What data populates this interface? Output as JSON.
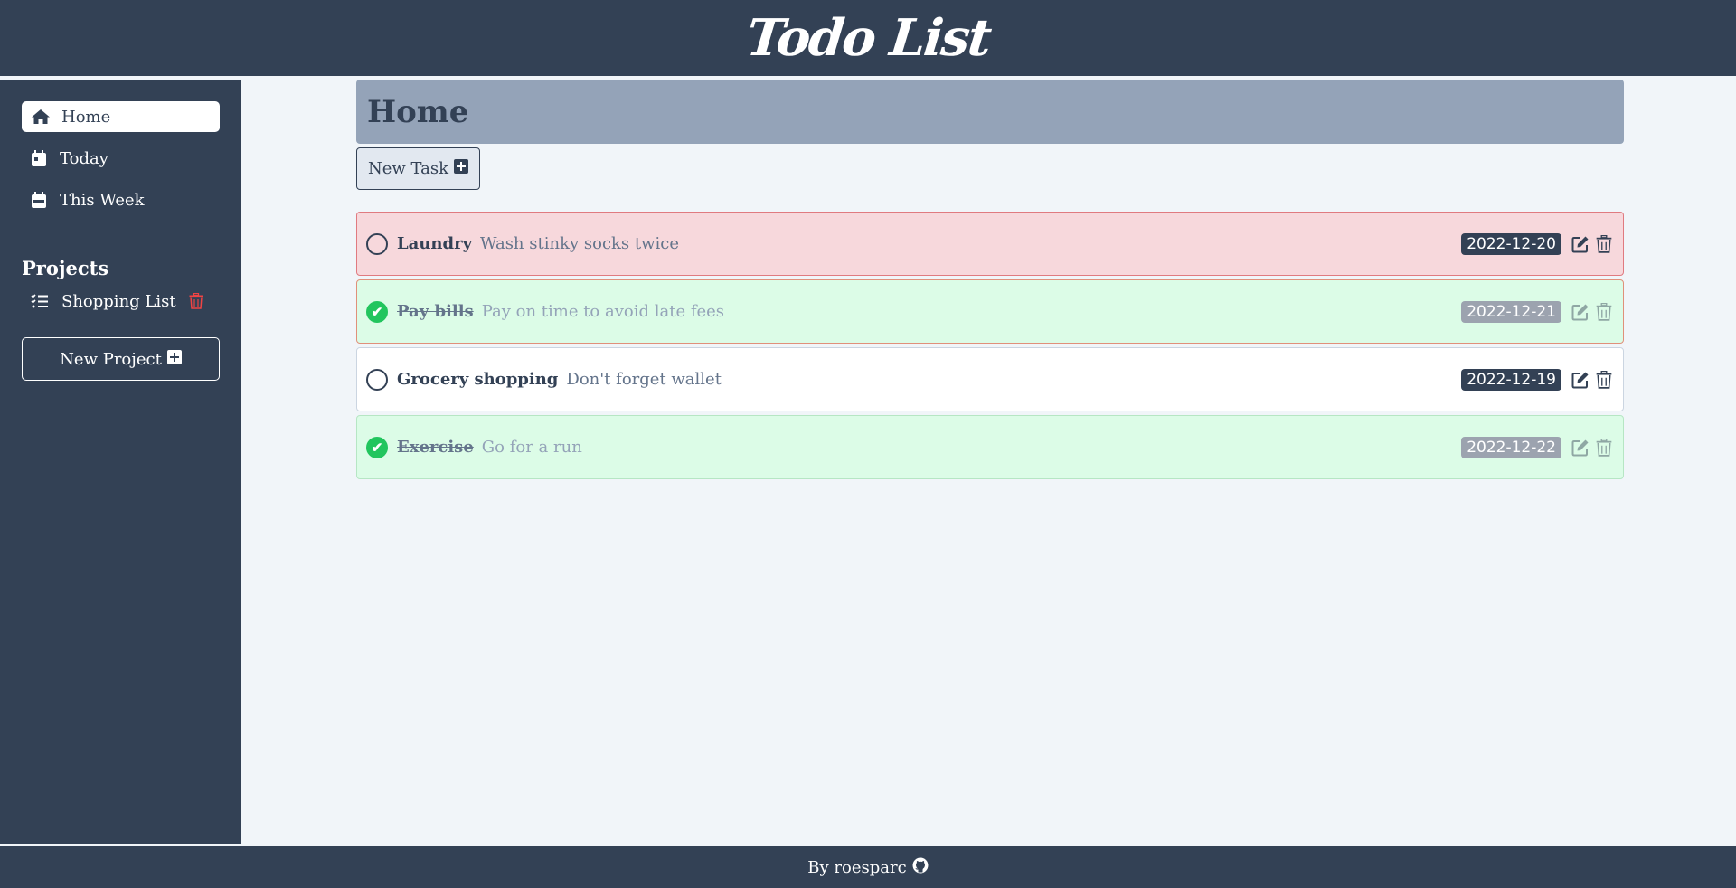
{
  "app": {
    "title": "Todo List"
  },
  "sidebar": {
    "nav": [
      {
        "label": "Home",
        "icon": "home-icon",
        "active": true
      },
      {
        "label": "Today",
        "icon": "calendar-day-icon",
        "active": false
      },
      {
        "label": "This Week",
        "icon": "calendar-week-icon",
        "active": false
      }
    ],
    "projects_title": "Projects",
    "projects": [
      {
        "label": "Shopping List",
        "icon": "list-check-icon"
      }
    ],
    "new_project_label": "New Project"
  },
  "main": {
    "heading": "Home",
    "new_task_label": "New Task",
    "tasks": [
      {
        "title": "Laundry",
        "description": "Wash stinky socks twice",
        "date": "2022-12-20",
        "done": false,
        "priority": "high"
      },
      {
        "title": "Pay bills",
        "description": "Pay on time to avoid late fees",
        "date": "2022-12-21",
        "done": true,
        "priority": "high"
      },
      {
        "title": "Grocery shopping",
        "description": "Don't forget wallet",
        "date": "2022-12-19",
        "done": false,
        "priority": "normal"
      },
      {
        "title": "Exercise",
        "description": "Go for a run",
        "date": "2022-12-22",
        "done": true,
        "priority": "normal"
      }
    ]
  },
  "footer": {
    "text": "By roesparc",
    "icon": "github-icon"
  },
  "colors": {
    "dark": "#334155",
    "background": "#f1f5f9",
    "heading_bg": "#94a3b8",
    "high_priority_bg": "#f7d8dc",
    "done_bg": "#dcfce7",
    "check_green": "#22c55e",
    "delete_red": "#ef4444"
  }
}
